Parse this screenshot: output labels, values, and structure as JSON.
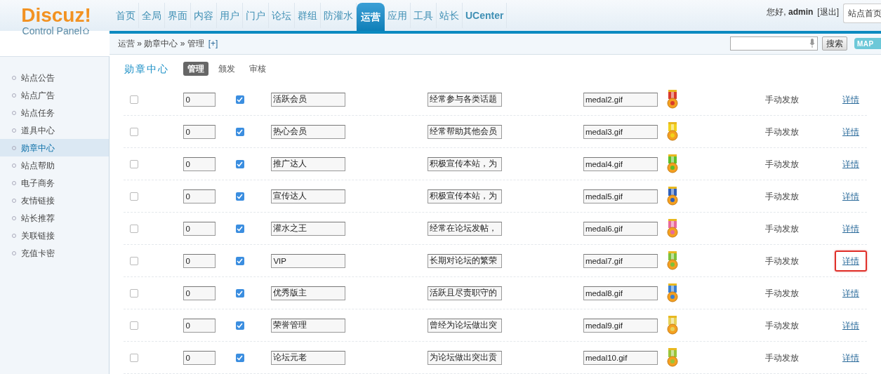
{
  "logo": {
    "title": "Discuz!",
    "subtitle": "Control Panel"
  },
  "nav": [
    {
      "label": "首页",
      "selected": false
    },
    {
      "label": "全局",
      "selected": false
    },
    {
      "label": "界面",
      "selected": false
    },
    {
      "label": "内容",
      "selected": false
    },
    {
      "label": "用户",
      "selected": false
    },
    {
      "label": "门户",
      "selected": false
    },
    {
      "label": "论坛",
      "selected": false
    },
    {
      "label": "群组",
      "selected": false
    },
    {
      "label": "防灌水",
      "selected": false
    },
    {
      "label": "运营",
      "selected": true
    },
    {
      "label": "应用",
      "selected": false
    },
    {
      "label": "工具",
      "selected": false
    },
    {
      "label": "站长",
      "selected": false
    },
    {
      "label": "UCenter",
      "selected": false
    }
  ],
  "user": {
    "greeting": "您好,",
    "name": "admin",
    "logout": "[退出]",
    "site_home": "站点首页"
  },
  "breadcrumb": {
    "text": "运营 » 勋章中心 » 管理",
    "add": "[+]"
  },
  "search": {
    "button": "搜索",
    "map": "MAP"
  },
  "sidebar": {
    "items": [
      {
        "label": "站点公告",
        "selected": false
      },
      {
        "label": "站点广告",
        "selected": false
      },
      {
        "label": "站点任务",
        "selected": false
      },
      {
        "label": "道具中心",
        "selected": false
      },
      {
        "label": "勋章中心",
        "selected": true
      },
      {
        "label": "站点帮助",
        "selected": false
      },
      {
        "label": "电子商务",
        "selected": false
      },
      {
        "label": "友情链接",
        "selected": false
      },
      {
        "label": "站长推荐",
        "selected": false
      },
      {
        "label": "关联链接",
        "selected": false
      },
      {
        "label": "充值卡密",
        "selected": false
      }
    ]
  },
  "section": {
    "title": "勋章中心",
    "tabs": [
      {
        "label": "管理",
        "selected": true
      },
      {
        "label": "颁发",
        "selected": false
      },
      {
        "label": "审核",
        "selected": false
      }
    ]
  },
  "rows": [
    {
      "delete": false,
      "order": "0",
      "available": true,
      "name": "活跃会员",
      "description": "经常参与各类话题",
      "image": "medal2.gif",
      "color": "#d93a2b",
      "method": "手动发放",
      "link": "详情",
      "highlighted": false
    },
    {
      "delete": false,
      "order": "0",
      "available": true,
      "name": "热心会员",
      "description": "经常帮助其他会员",
      "image": "medal3.gif",
      "color": "#f2d21b",
      "method": "手动发放",
      "link": "详情",
      "highlighted": false
    },
    {
      "delete": false,
      "order": "0",
      "available": true,
      "name": "推广达人",
      "description": "积极宣传本站，为",
      "image": "medal4.gif",
      "color": "#5cbf2a",
      "method": "手动发放",
      "link": "详情",
      "highlighted": false
    },
    {
      "delete": false,
      "order": "0",
      "available": true,
      "name": "宣传达人",
      "description": "积极宣传本站，为",
      "image": "medal5.gif",
      "color": "#2f5fb8",
      "method": "手动发放",
      "link": "详情",
      "highlighted": false
    },
    {
      "delete": false,
      "order": "0",
      "available": true,
      "name": "灌水之王",
      "description": "经常在论坛发帖，",
      "image": "medal6.gif",
      "color": "#e86a9a",
      "method": "手动发放",
      "link": "详情",
      "highlighted": false
    },
    {
      "delete": false,
      "order": "0",
      "available": true,
      "name": "VIP",
      "description": "长期对论坛的繁荣",
      "image": "medal7.gif",
      "color": "#7cc03a",
      "method": "手动发放",
      "link": "详情",
      "highlighted": true
    },
    {
      "delete": false,
      "order": "0",
      "available": true,
      "name": "优秀版主",
      "description": "活跃且尽责职守的",
      "image": "medal8.gif",
      "color": "#3b7fd0",
      "method": "手动发放",
      "link": "详情",
      "highlighted": false
    },
    {
      "delete": false,
      "order": "0",
      "available": true,
      "name": "荣誉管理",
      "description": "曾经为论坛做出突",
      "image": "medal9.gif",
      "color": "#e6d25a",
      "method": "手动发放",
      "link": "详情",
      "highlighted": false
    },
    {
      "delete": false,
      "order": "0",
      "available": true,
      "name": "论坛元老",
      "description": "为论坛做出突出贡",
      "image": "medal10.gif",
      "color": "#9ac43a",
      "method": "手动发放",
      "link": "详情",
      "highlighted": false
    }
  ]
}
